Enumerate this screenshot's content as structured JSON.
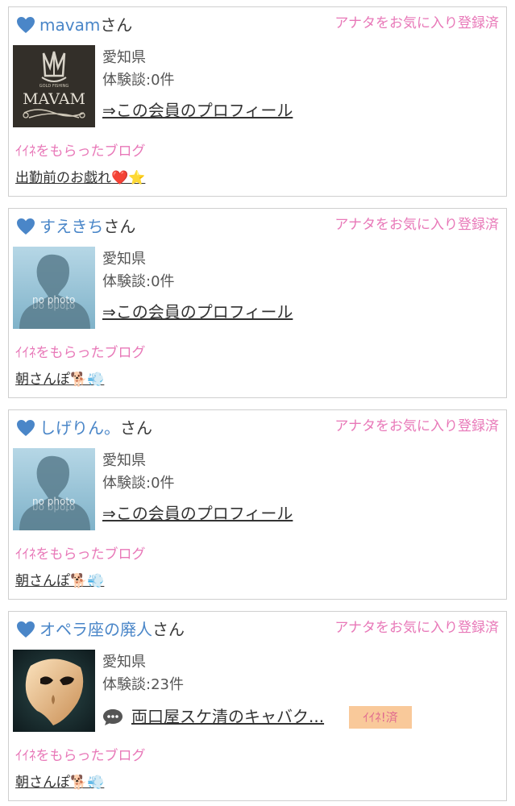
{
  "shared": {
    "fav_status": "アナタをお気に入り登録済",
    "blog_label": "ｲｲﾈをもらったブログ",
    "profile_link": "⇒この会員のプロフィール",
    "name_suffix": "さん",
    "no_photo": "no photo"
  },
  "colors": {
    "pink": "#e878b8",
    "link_blue": "#4a86c8",
    "badge_bg": "#f9c99a"
  },
  "members": [
    {
      "name": "mavam",
      "prefecture": "愛知県",
      "reviews": "体験談:0件",
      "avatar_text": "MAVAM",
      "avatar_small_text": "GOLD FISHING",
      "blog_title": "出勤前のお戯れ❤️⭐"
    },
    {
      "name": "すえきち",
      "prefecture": "愛知県",
      "reviews": "体験談:0件",
      "blog_title": "朝さんぽ🐕💨"
    },
    {
      "name": "しげりん。",
      "prefecture": "愛知県",
      "reviews": "体験談:0件",
      "blog_title": "朝さんぽ🐕💨"
    },
    {
      "name": "オペラ座の廃人",
      "prefecture": "愛知県",
      "reviews": "体験談:23件",
      "latest_review": "両口屋スケ清のキャバク...",
      "like_badge": "ｲｲﾈ!済",
      "blog_title": "朝さんぽ🐕💨"
    }
  ]
}
